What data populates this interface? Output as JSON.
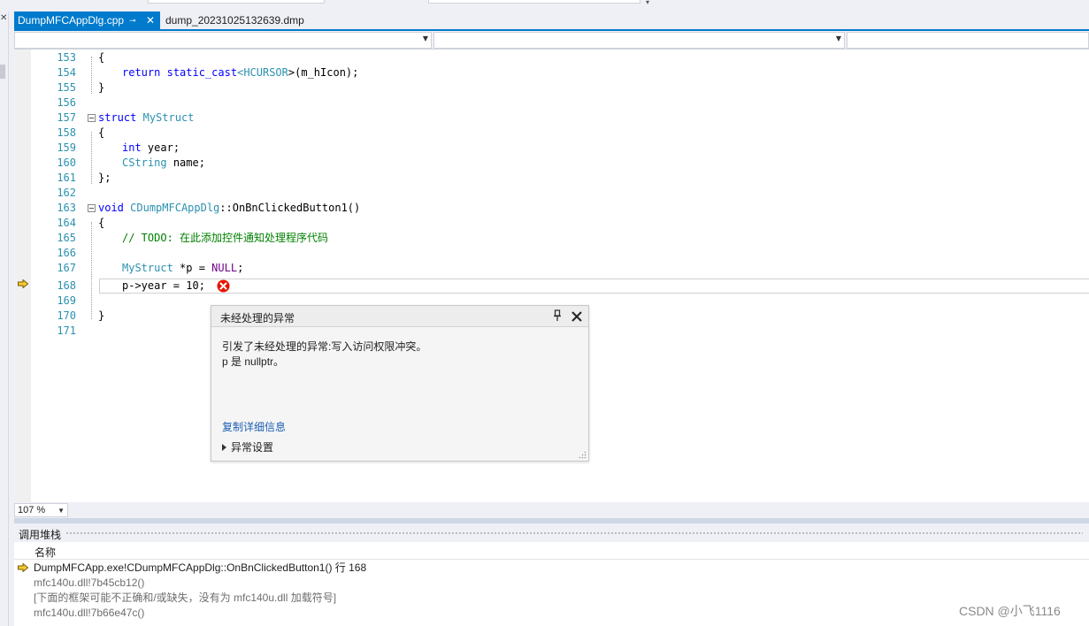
{
  "tabs": [
    {
      "label": "DumpMFCAppDlg.cpp",
      "pin": "⊸",
      "close": "✕"
    },
    {
      "label": "dump_20231025132639.dmp"
    }
  ],
  "left_strip": {
    "close_glyph": "✕"
  },
  "code_lines": [
    {
      "num": "153"
    },
    {
      "num": "154"
    },
    {
      "num": "155"
    },
    {
      "num": "156"
    },
    {
      "num": "157"
    },
    {
      "num": "158"
    },
    {
      "num": "159"
    },
    {
      "num": "160"
    },
    {
      "num": "161"
    },
    {
      "num": "162"
    },
    {
      "num": "163"
    },
    {
      "num": "164"
    },
    {
      "num": "165"
    },
    {
      "num": "166"
    },
    {
      "num": "167"
    },
    {
      "num": "168"
    },
    {
      "num": "169"
    },
    {
      "num": "170"
    },
    {
      "num": "171"
    }
  ],
  "code": {
    "l153": "{",
    "l154_kw": "return",
    "l154_cast": "static_cast",
    "l154_lt": "<",
    "l154_type": "HCURSOR",
    "l154_rest": ">(m_hIcon);",
    "l155": "}",
    "l157_kw": "struct",
    "l157_name": "MyStruct",
    "l158": "{",
    "l159_kw": "int",
    "l159_rest": "year;",
    "l160_type": "CString",
    "l160_rest": "name;",
    "l161": "};",
    "l163_kw": "void",
    "l163_class": "CDumpMFCAppDlg",
    "l163_rest": "::OnBnClickedButton1()",
    "l164": "{",
    "l165_comment": "// TODO: 在此添加控件通知处理程序代码",
    "l167_type": "MyStruct",
    "l167_mid": "*p =",
    "l167_macro": "NULL",
    "l167_end": ";",
    "l168": "p->year = 10;",
    "l170": "}"
  },
  "exception_popup": {
    "title": "未经处理的异常",
    "message_line1": "引发了未经处理的异常:写入访问权限冲突。",
    "message_line2": "p 是 nullptr。",
    "copy_details_link": "复制详细信息",
    "exception_settings": "异常设置"
  },
  "zoom": {
    "value": "107 %"
  },
  "call_stack": {
    "title": "调用堆栈",
    "column_name": "名称",
    "rows": [
      {
        "text": "DumpMFCApp.exe!CDumpMFCAppDlg::OnBnClickedButton1() 行 168",
        "current": true
      },
      {
        "text": "mfc140u.dll!7b45cb12()",
        "current": false
      },
      {
        "text": "[下面的框架可能不正确和/或缺失，没有为 mfc140u.dll 加载符号]",
        "current": false
      },
      {
        "text": "mfc140u.dll!7b66e47c()",
        "current": false
      },
      {
        "text": "",
        "current": false
      }
    ]
  },
  "watermark": "CSDN @小飞1116",
  "colors": {
    "accent": "#007acc",
    "keyword": "#0000ff",
    "type": "#2b91af",
    "comment": "#008000",
    "macro": "#6f008a",
    "error": "#e51400",
    "link": "#1e5fb4",
    "arrow": "#f5cc30"
  },
  "icons": {
    "error": "error-icon",
    "execution_pointer": "current-statement-arrow-icon",
    "popup_pin": "pin-icon",
    "popup_close": "close-icon",
    "expand": "expand-triangle-icon"
  }
}
